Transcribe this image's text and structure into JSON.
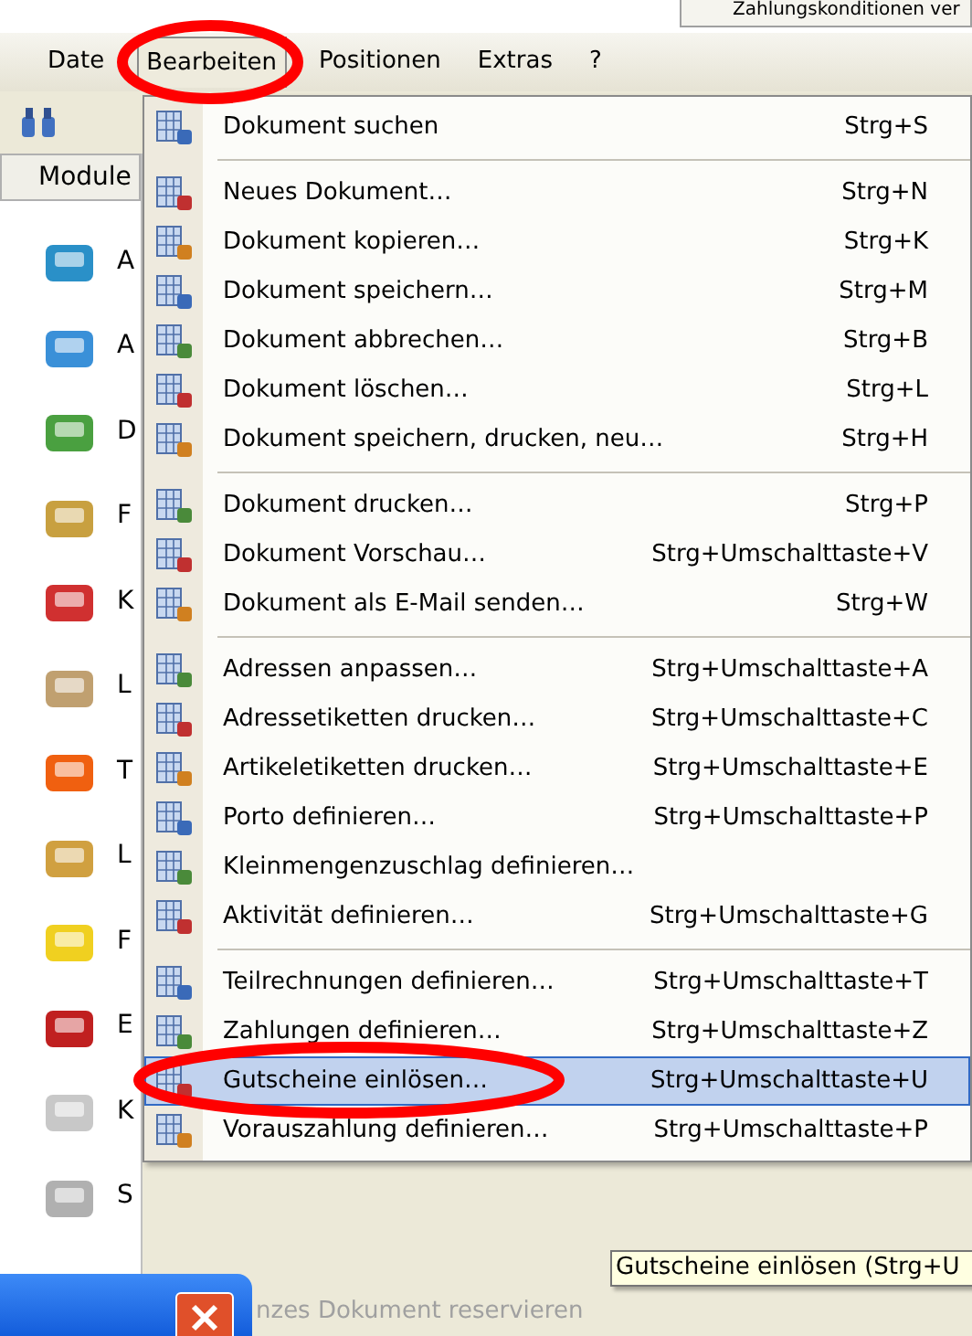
{
  "background_panel": {
    "text": "Zahlungskonditionen ver"
  },
  "menubar": [
    {
      "label": "Date",
      "selected": false
    },
    {
      "label": "Bearbeiten",
      "selected": true
    },
    {
      "label": "Positionen",
      "selected": false
    },
    {
      "label": "Extras",
      "selected": false
    },
    {
      "label": "?",
      "selected": false
    }
  ],
  "module_tab": {
    "label": "Module"
  },
  "modules": [
    "A",
    "A",
    "D",
    "F",
    "K",
    "L",
    "T",
    "L",
    "F",
    "E",
    "K",
    "S"
  ],
  "menu": [
    {
      "kind": "item",
      "label": "Dokument suchen",
      "shortcut": "Strg+S",
      "selected": false
    },
    {
      "kind": "separator"
    },
    {
      "kind": "item",
      "label": "Neues Dokument…",
      "shortcut": "Strg+N",
      "selected": false
    },
    {
      "kind": "item",
      "label": "Dokument kopieren…",
      "shortcut": "Strg+K",
      "selected": false
    },
    {
      "kind": "item",
      "label": "Dokument speichern…",
      "shortcut": "Strg+M",
      "selected": false
    },
    {
      "kind": "item",
      "label": "Dokument abbrechen…",
      "shortcut": "Strg+B",
      "selected": false
    },
    {
      "kind": "item",
      "label": "Dokument löschen…",
      "shortcut": "Strg+L",
      "selected": false
    },
    {
      "kind": "item",
      "label": "Dokument speichern, drucken, neu…",
      "shortcut": "Strg+H",
      "selected": false
    },
    {
      "kind": "separator"
    },
    {
      "kind": "item",
      "label": "Dokument drucken…",
      "shortcut": "Strg+P",
      "selected": false
    },
    {
      "kind": "item",
      "label": "Dokument Vorschau…",
      "shortcut": "Strg+Umschalttaste+V",
      "selected": false
    },
    {
      "kind": "item",
      "label": "Dokument als E-Mail senden…",
      "shortcut": "Strg+W",
      "selected": false
    },
    {
      "kind": "separator"
    },
    {
      "kind": "item",
      "label": "Adressen anpassen…",
      "shortcut": "Strg+Umschalttaste+A",
      "selected": false
    },
    {
      "kind": "item",
      "label": "Adressetiketten drucken…",
      "shortcut": "Strg+Umschalttaste+C",
      "selected": false
    },
    {
      "kind": "item",
      "label": "Artikeletiketten drucken…",
      "shortcut": "Strg+Umschalttaste+E",
      "selected": false
    },
    {
      "kind": "item",
      "label": "Porto definieren…",
      "shortcut": "Strg+Umschalttaste+P",
      "selected": false
    },
    {
      "kind": "item",
      "label": "Kleinmengenzuschlag definieren…",
      "selected": false
    },
    {
      "kind": "item",
      "label": "Aktivität definieren…",
      "shortcut": "Strg+Umschalttaste+G",
      "selected": false
    },
    {
      "kind": "separator"
    },
    {
      "kind": "item",
      "label": "Teilrechnungen definieren…",
      "shortcut": "Strg+Umschalttaste+T",
      "selected": false
    },
    {
      "kind": "item",
      "label": "Zahlungen definieren…",
      "shortcut": "Strg+Umschalttaste+Z",
      "selected": false
    },
    {
      "kind": "item",
      "label": "Gutscheine einlösen…",
      "shortcut": "Strg+Umschalttaste+U",
      "selected": true
    },
    {
      "kind": "item",
      "label": "Vorauszahlung definieren…",
      "shortcut": "Strg+Umschalttaste+P",
      "selected": false
    }
  ],
  "tooltip": "Gutscheine einlösen (Strg+U",
  "behind_text": "nzes Dokument reservieren"
}
